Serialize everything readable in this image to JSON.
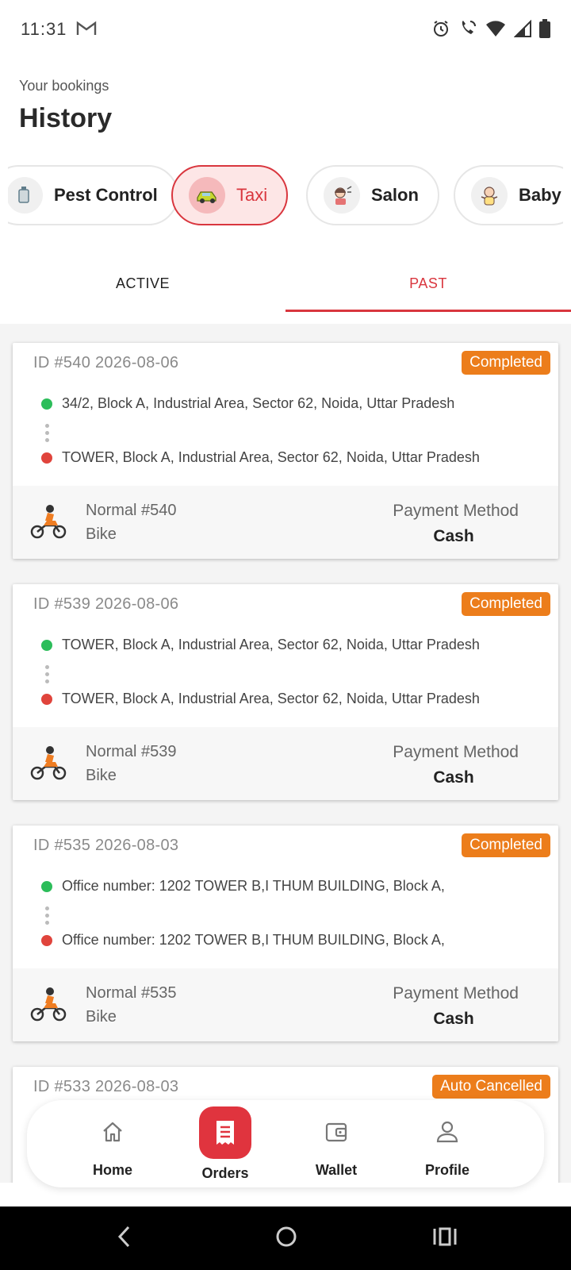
{
  "status_bar": {
    "time": "11:31"
  },
  "header": {
    "subtitle": "Your bookings",
    "title": "History"
  },
  "categories": [
    {
      "label": "Pest Control",
      "icon": "pest-control-icon",
      "active": false
    },
    {
      "label": "Taxi",
      "icon": "taxi-icon",
      "active": true
    },
    {
      "label": "Salon",
      "icon": "salon-icon",
      "active": false
    },
    {
      "label": "Baby",
      "icon": "baby-icon",
      "active": false
    }
  ],
  "tabs": [
    {
      "label": "ACTIVE",
      "active": false
    },
    {
      "label": "PAST",
      "active": true
    }
  ],
  "bookings": [
    {
      "id_date": "ID #540 2026-08-06",
      "status": "Completed",
      "pickup": "34/2, Block A, Industrial Area, Sector 62, Noida, Uttar Pradesh",
      "drop": "TOWER, Block A, Industrial Area, Sector 62, Noida, Uttar Pradesh",
      "ride_type": "Normal  #540",
      "vehicle": "Bike",
      "payment_label": "Payment Method",
      "payment_value": "Cash"
    },
    {
      "id_date": "ID #539 2026-08-06",
      "status": "Completed",
      "pickup": "TOWER, Block A, Industrial Area, Sector 62, Noida, Uttar Pradesh",
      "drop": "TOWER, Block A, Industrial Area, Sector 62, Noida, Uttar Pradesh",
      "ride_type": "Normal  #539",
      "vehicle": "Bike",
      "payment_label": "Payment Method",
      "payment_value": "Cash"
    },
    {
      "id_date": "ID #535 2026-08-03",
      "status": "Completed",
      "pickup": "Office number: 1202 TOWER B,I THUM BUILDING, Block A,",
      "drop": "Office number: 1202 TOWER B,I THUM BUILDING, Block A,",
      "ride_type": "Normal  #535",
      "vehicle": "Bike",
      "payment_label": "Payment Method",
      "payment_value": "Cash"
    }
  ],
  "partial_card": {
    "id_date": "ID #533 2026-08-03",
    "status": "Auto Cancelled"
  },
  "bottom_nav": [
    {
      "label": "Home",
      "icon": "home-icon",
      "active": false
    },
    {
      "label": "Orders",
      "icon": "orders-icon",
      "active": true
    },
    {
      "label": "Wallet",
      "icon": "wallet-icon",
      "active": false
    },
    {
      "label": "Profile",
      "icon": "profile-icon",
      "active": false
    }
  ],
  "colors": {
    "accent": "#d9363e",
    "badge": "#ec7d1b",
    "pickup_dot": "#2cbd5a",
    "drop_dot": "#e0443c"
  }
}
